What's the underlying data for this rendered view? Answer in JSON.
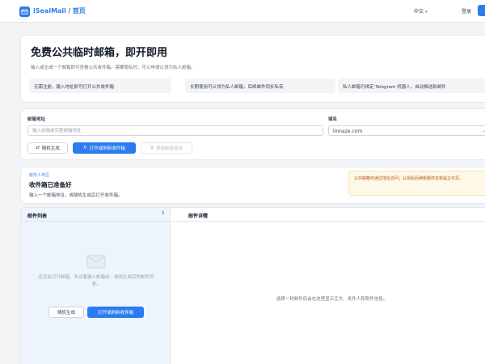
{
  "app": {
    "brand": "iSealMail",
    "brand_sep": " / ",
    "brand_sub": "首页"
  },
  "nav": {
    "language": "中文",
    "login": "登录"
  },
  "hero": {
    "title": "免费公共临时邮箱，即开即用",
    "subtitle": "输入或生成一个邮箱即可查看公共收件箱。需要隐私时，可以申请认领为私人邮箱。",
    "features": [
      "无需注册，输入地址即可打开公共收件箱",
      "长期使用可认领为私人邮箱，后续邮件同步私有",
      "私人邮箱可绑定 Telegram 机器人，自动推送新邮件"
    ]
  },
  "form": {
    "address_label": "邮箱地址",
    "address_value": "",
    "address_placeholder": "输入前缀或完整邮箱地址",
    "domain_label": "域名",
    "domain_value": "linnaze.com",
    "buttons": {
      "random": "随机生成",
      "open": "打开或刷新收件箱",
      "copy": "复制邮箱地址"
    }
  },
  "inbox": {
    "zone_tag": "收件人专区",
    "title": "收件箱已准备好",
    "subtitle": "输入一个邮箱地址，或随机生成后打开收件箱。",
    "notice": "公共邮箱可通过地址访问；认领后后续新邮件仅有属主可见。"
  },
  "list": {
    "title": "邮件列表",
    "empty_text": "还没有打开邮箱，先试着输入邮箱前，或用生成后的邮件列表。",
    "random_button": "随机生成",
    "open_button": "打开或刷新收件箱"
  },
  "detail": {
    "title": "邮件详情",
    "empty_text": "选择一封邮件后会在这里显示正文、发件人和附件信息。"
  },
  "colors": {
    "accent": "#2b7cf0",
    "notice_bg": "#fef9e7",
    "notice_text": "#b45309"
  }
}
